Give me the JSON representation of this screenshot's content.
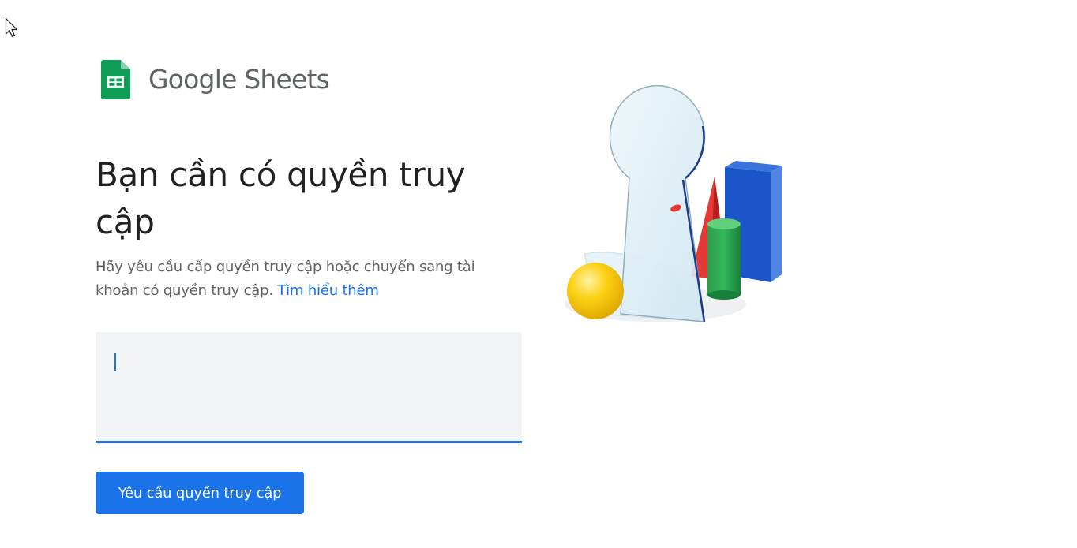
{
  "brand": {
    "name": "Google Sheets"
  },
  "main": {
    "title": "Bạn cần có quyền truy cập",
    "description": "Hãy yêu cầu cấp quyền truy cập hoặc chuyển sang tài khoản có quyền truy cập.",
    "learn_more_link": "Tìm hiểu thêm",
    "message_input": {
      "value": "",
      "placeholder": ""
    },
    "request_button_label": "Yêu cầu quyền truy cập"
  },
  "colors": {
    "accent": "#1a73e8",
    "sheets_green": "#0f9d58",
    "title_text": "#202124",
    "secondary_text": "#5f6368",
    "input_background": "#f1f3f4"
  },
  "icons": {
    "logo": "google-sheets-icon",
    "illustration": "keyhole-shapes-illustration",
    "pointer": "mouse-cursor-icon"
  }
}
